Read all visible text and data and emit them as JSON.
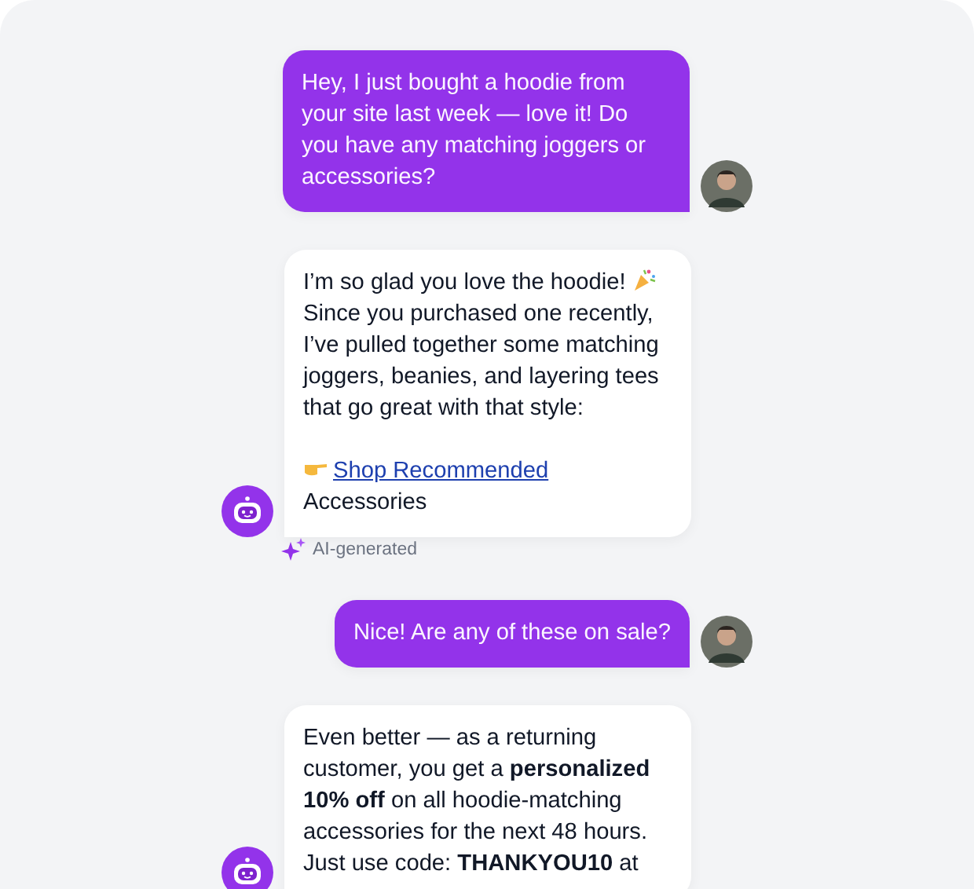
{
  "messages": [
    {
      "kind": "user",
      "text": "Hey, I just bought a hoodie from your site last week — love it! Do you have any matching joggers or accessories?"
    },
    {
      "kind": "bot",
      "lead": "I’m so glad you love the hoodie!",
      "text": "Since you purchased one recently, I’ve pulled together some matching joggers, beanies, and layering tees that go great with that style:",
      "link": "Shop Recommended",
      "after": "Accessories",
      "ai_label": "AI-generated"
    },
    {
      "kind": "user",
      "text": "Nice! Are any of these on sale?"
    },
    {
      "kind": "bot",
      "text": "Even better — as a returning customer, you get a **personalized 10% off** on all hoodie-matching accessories for the next 48 hours. Just use code: **THANKYOU10** at"
    }
  ]
}
